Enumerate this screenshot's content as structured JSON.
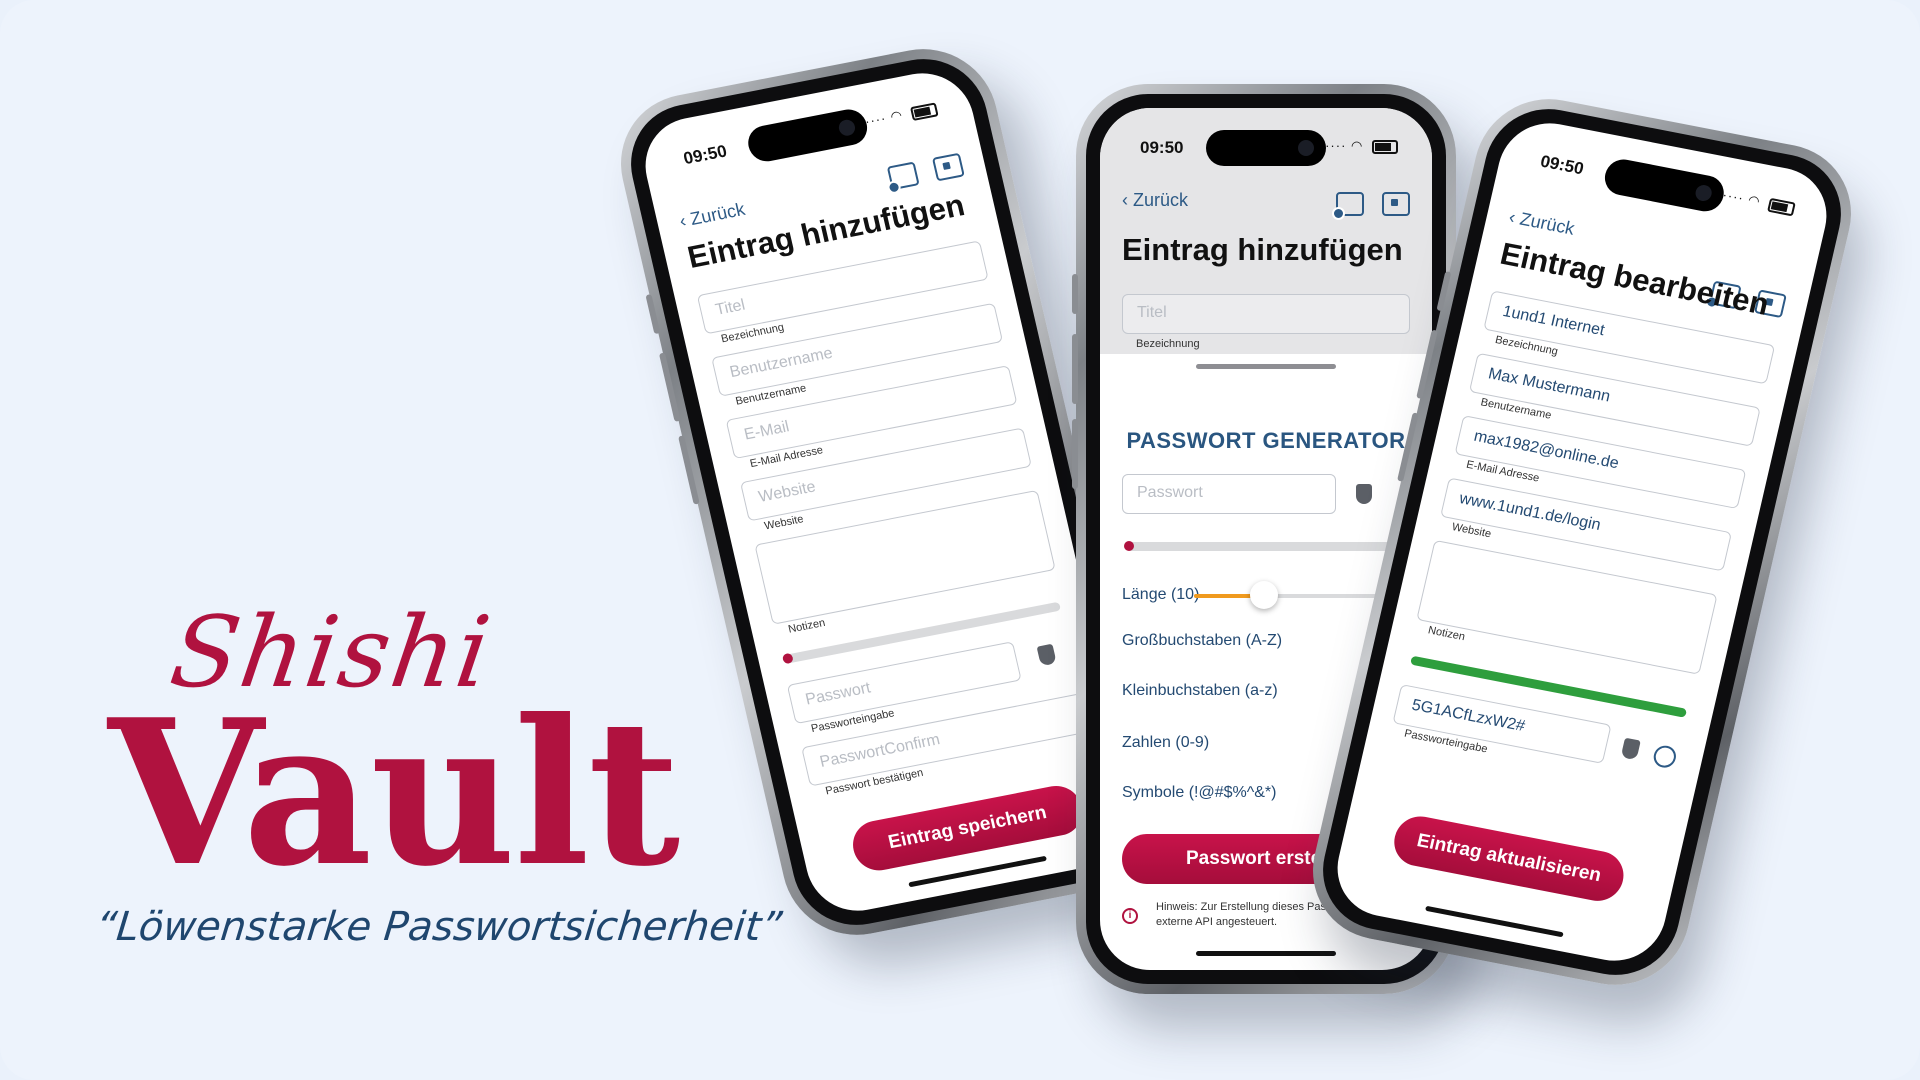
{
  "brand": {
    "script": "Shishi",
    "name": "Vault",
    "tagline": "“Löwenstarke Passwortsicherheit”"
  },
  "colors": {
    "brand": "#b0123f",
    "accent": "#2d5a86",
    "meter_strong": "#2e9e3d",
    "slider": "#f09a1e"
  },
  "phone1": {
    "time": "09:50",
    "back_label": "Zurück",
    "title": "Eintrag hinzufügen",
    "fields": {
      "title": {
        "placeholder": "Titel",
        "label": "Bezeichnung"
      },
      "username": {
        "placeholder": "Benutzername",
        "label": "Benutzername"
      },
      "email": {
        "placeholder": "E-Mail",
        "label": "E-Mail Adresse"
      },
      "website": {
        "placeholder": "Website",
        "label": "Website"
      },
      "notes": {
        "label": "Notizen"
      },
      "password": {
        "placeholder": "Passwort",
        "label": "Passworteingabe"
      },
      "password_confirm": {
        "placeholder": "PasswortConfirm",
        "label": "Passwort bestätigen"
      }
    },
    "save_button": "Eintrag speichern"
  },
  "phone2": {
    "time": "09:50",
    "back_label": "Zurück",
    "title": "Eintrag hinzufügen",
    "title_field": {
      "placeholder": "Titel",
      "label": "Bezeichnung"
    },
    "generator_title": "PASSWORT GENERATOR",
    "password_placeholder": "Passwort",
    "length_label": "Länge (10)",
    "length_value": 10,
    "options": [
      "Großbuchstaben (A-Z)",
      "Kleinbuchstaben (a-z)",
      "Zahlen (0-9)",
      "Symbole (!@#$%^&*)"
    ],
    "create_button": "Passwort erstellen",
    "hint": "Hinweis: Zur Erstellung dieses Passworts wird eine externe API angesteuert."
  },
  "phone3": {
    "time": "09:50",
    "back_label": "Zurück",
    "title": "Eintrag bearbeiten",
    "fields": {
      "title": {
        "value": "1und1 Internet",
        "label": "Bezeichnung"
      },
      "username": {
        "value": "Max Mustermann",
        "label": "Benutzername"
      },
      "email": {
        "value": "max1982@online.de",
        "label": "E-Mail Adresse"
      },
      "website": {
        "value": "www.1und1.de/login",
        "label": "Website"
      },
      "notes": {
        "label": "Notizen"
      },
      "password": {
        "value": "5G1ACfLzxW2#",
        "label": "Passworteingabe"
      }
    },
    "update_button": "Eintrag aktualisieren"
  }
}
